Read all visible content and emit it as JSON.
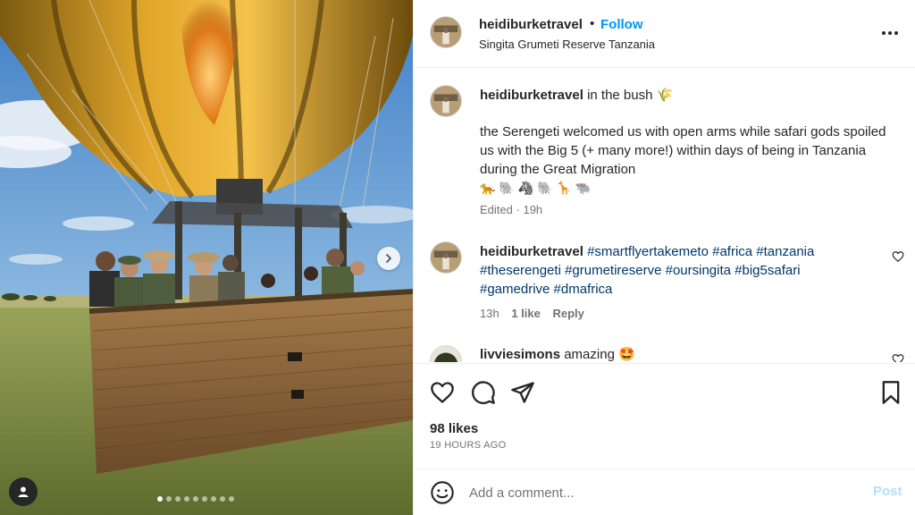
{
  "post": {
    "username": "heidiburketravel",
    "separator": "•",
    "follow_label": "Follow",
    "location": "Singita Grumeti Reserve Tanzania",
    "caption": {
      "username": "heidiburketravel",
      "headline": "in the bush 🌾",
      "text": "the Serengeti welcomed us with open arms while safari gods spoiled us with the Big 5 (+ many more!) within days of being in Tanzania during the Great Migration",
      "emojis": "🐆 🐘 🦓 🐘 🦒 🐃",
      "edited": "Edited",
      "dot": "·",
      "age": "19h"
    },
    "comments": [
      {
        "username": "heidiburketravel",
        "line1": "#smartflyertakemeto #africa #tanzania",
        "line2": "#theserengeti #grumetireserve #oursingita #big5safari",
        "line3": "#gamedrive #dmafrica",
        "age": "13h",
        "likes": "1 like",
        "reply_label": "Reply"
      },
      {
        "username": "livviesimons",
        "text": "amazing 🤩"
      }
    ],
    "likes": "98 likes",
    "timestamp": "19 HOURS AGO",
    "add_comment_placeholder": "Add a comment...",
    "post_label": "Post"
  },
  "carousel": {
    "slide_count": 9,
    "active_index": 0
  },
  "icons": {
    "more": "more-options-icon",
    "next": "chevron-right-icon",
    "tag": "user-tag-icon",
    "like": "heart-icon",
    "comment": "comment-icon",
    "share": "share-icon",
    "save": "bookmark-icon",
    "emoji": "emoji-icon"
  },
  "colors": {
    "accent": "#0095f6",
    "hashtag": "#00376b",
    "secondary_text": "#737373",
    "post_disabled": "#b2dffc",
    "divider": "#efefef"
  }
}
